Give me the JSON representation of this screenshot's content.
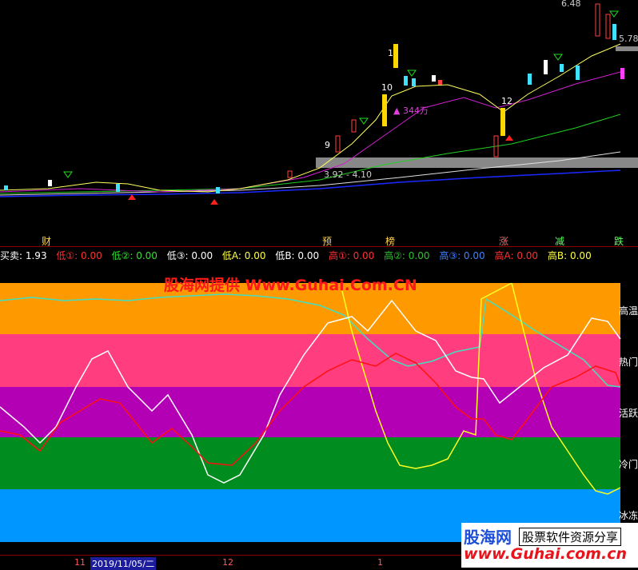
{
  "kline": {
    "price_labels": {
      "top": "6.48",
      "right": "5.78",
      "v10": "10",
      "v9": "9",
      "v12": "12",
      "v1": "1",
      "range": "3.92 - 4.10",
      "volume": "▲ 344万"
    },
    "event_labels": [
      "财",
      "预",
      "榜",
      "涨",
      "减",
      "跌"
    ]
  },
  "legend": {
    "items": [
      {
        "text": "买卖: 1.93",
        "color": "#ffffff"
      },
      {
        "text": "低①: 0.00",
        "color": "#ff3030"
      },
      {
        "text": "低②: 0.00",
        "color": "#30e030"
      },
      {
        "text": "低③: 0.00",
        "color": "#ffffff"
      },
      {
        "text": "低A: 0.00",
        "color": "#ffff40"
      },
      {
        "text": "低B: 0.00",
        "color": "#ffffff"
      },
      {
        "text": "高①: 0.00",
        "color": "#ff3030"
      },
      {
        "text": "高②: 0.00",
        "color": "#30c030"
      },
      {
        "text": "高③: 0.00",
        "color": "#4080ff"
      },
      {
        "text": "高A: 0.00",
        "color": "#ff3030"
      },
      {
        "text": "高B: 0.00",
        "color": "#ffff40"
      }
    ]
  },
  "watermark": "股海网提供 Www.Guhai.Com.CN",
  "zones": [
    {
      "label": "高温",
      "color": "#ff9900"
    },
    {
      "label": "热门",
      "color": "#ff3d7f"
    },
    {
      "label": "活跃",
      "color": "#b400b4"
    },
    {
      "label": "冷门",
      "color": "#008c1e"
    },
    {
      "label": "冰冻",
      "color": "#0096ff"
    }
  ],
  "axis": {
    "labels": [
      "11",
      "2019/11/05/二",
      "12",
      "1"
    ]
  },
  "logo": {
    "name": "股海网",
    "slogan": "股票软件资源分享",
    "url": "www.Guhai.com.cn"
  }
}
